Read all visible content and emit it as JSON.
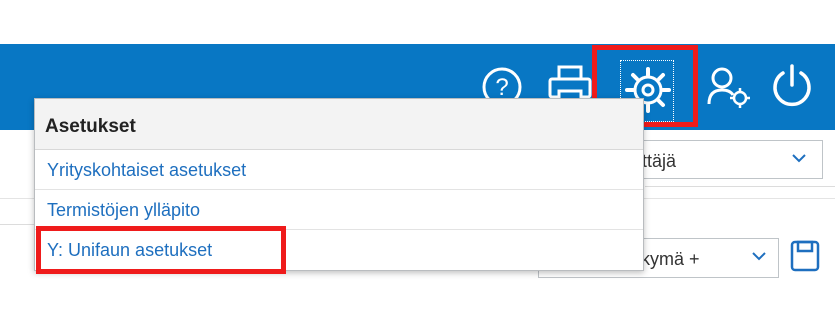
{
  "header": {
    "icons": [
      "help-icon",
      "print-icon",
      "gear-icon",
      "user-settings-icon",
      "power-icon"
    ]
  },
  "settings_menu": {
    "title": "Asetukset",
    "items": [
      {
        "label": "Yrityskohtaiset asetukset"
      },
      {
        "label": "Termistöjen ylläpito"
      },
      {
        "label": "Y: Unifaun asetukset"
      }
    ]
  },
  "user_select": {
    "value_fragment": "yttäjä"
  },
  "view_select": {
    "value_fragment": "äkymä +",
    "prefix_fragment": "y"
  },
  "colors": {
    "header_bg": "#0877c4",
    "highlight": "#ef1b1b",
    "link": "#1e6fbf"
  }
}
